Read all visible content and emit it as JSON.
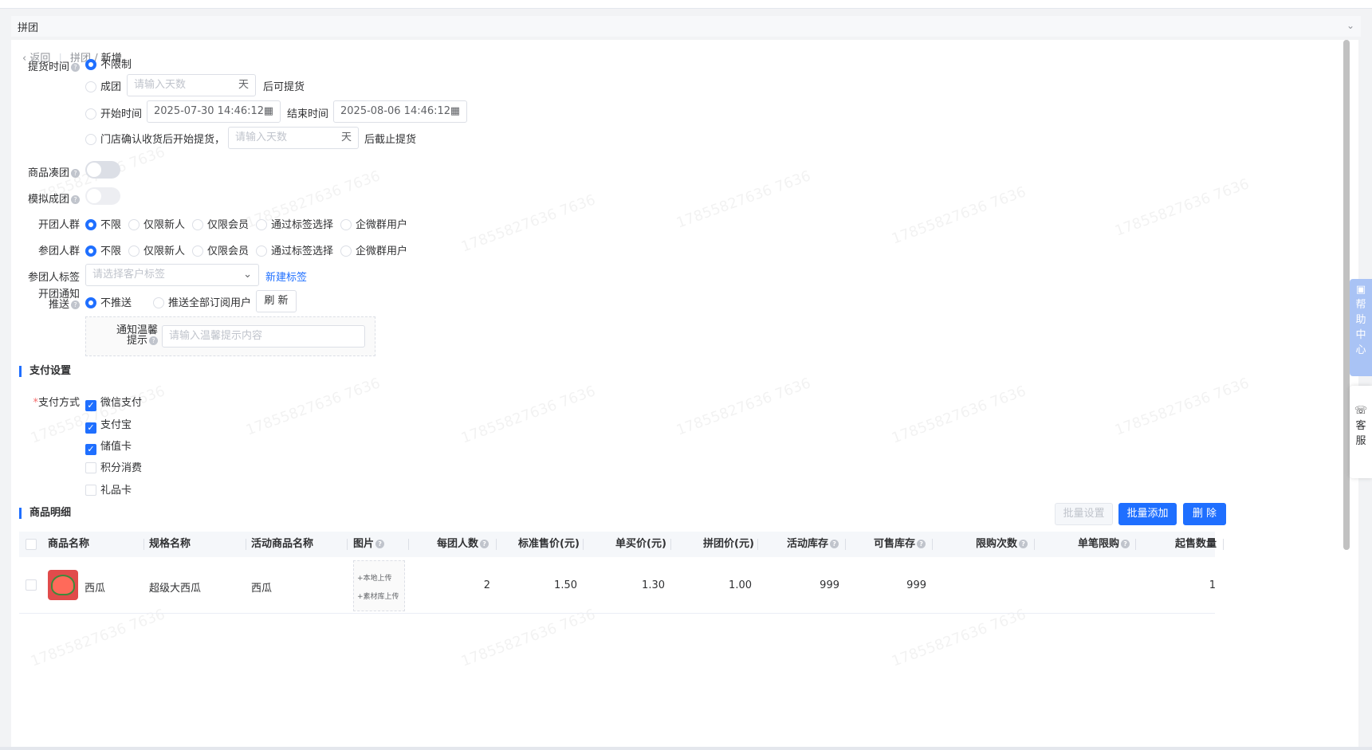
{
  "tab": {
    "label": "拼团"
  },
  "breadcrumb": {
    "back": "返回",
    "parent": "拼团",
    "current": "新增"
  },
  "pickup": {
    "label": "提货时间",
    "opt_unlimited": "不限制",
    "opt_group": "成团",
    "days_placeholder": "请输入天数",
    "days_unit": "天",
    "after_pickup": "后可提货",
    "opt_start": "开始时间",
    "start_value": "2025-07-30 14:46:12",
    "end_label": "结束时间",
    "end_value": "2025-08-06 14:46:12",
    "opt_store": "门店确认收货后开始提货，",
    "store_placeholder": "请输入天数",
    "store_unit": "天",
    "after_stop": "后截止提货"
  },
  "gather": {
    "label": "商品凑团"
  },
  "simulate": {
    "label": "模拟成团"
  },
  "opener": {
    "label": "开团人群",
    "options": [
      "不限",
      "仅限新人",
      "仅限会员",
      "通过标签选择",
      "企微群用户"
    ],
    "selected": 0
  },
  "joiner": {
    "label": "参团人群",
    "options": [
      "不限",
      "仅限新人",
      "仅限会员",
      "通过标签选择",
      "企微群用户"
    ],
    "selected": 0
  },
  "tags": {
    "label": "参团人标签",
    "placeholder": "请选择客户标签",
    "new_link": "新建标签"
  },
  "notify": {
    "label_line1": "开团通知",
    "label_line2": "推送",
    "opt_none": "不推送",
    "opt_all": "推送全部订阅用户",
    "refresh": "刷 新",
    "tip_label_line1": "通知温馨",
    "tip_label_line2": "提示",
    "tip_placeholder": "请输入温馨提示内容"
  },
  "payment": {
    "section": "支付设置",
    "label": "支付方式",
    "required": "*",
    "methods": [
      {
        "name": "微信支付",
        "checked": true
      },
      {
        "name": "支付宝",
        "checked": true
      },
      {
        "name": "储值卡",
        "checked": true
      },
      {
        "name": "积分消费",
        "checked": false
      },
      {
        "name": "礼品卡",
        "checked": false
      }
    ]
  },
  "goods": {
    "section": "商品明细",
    "batch_set": "批量设置",
    "batch_add": "批量添加",
    "delete": "删 除",
    "columns": [
      "商品名称",
      "规格名称",
      "活动商品名称",
      "图片",
      "每团人数",
      "标准售价(元)",
      "单买价(元)",
      "拼团价(元)",
      "活动库存",
      "可售库存",
      "限购次数",
      "单笔限购",
      "起售数量"
    ],
    "rows": [
      {
        "name": "西瓜",
        "spec": "超级大西瓜",
        "activity_name": "西瓜",
        "upload_local": "+本地上传",
        "upload_lib": "+素材库上传",
        "per_group": "2",
        "std_price": "1.50",
        "single_price": "1.30",
        "group_price": "1.00",
        "activity_stock": "999",
        "sale_stock": "999",
        "limit_times": "",
        "limit_per_order": "",
        "min_qty": "1"
      }
    ]
  },
  "sidebar": {
    "help": [
      "帮",
      "助",
      "中",
      "心"
    ],
    "service": [
      "客",
      "服"
    ]
  },
  "watermark": "17855827636 7636",
  "colors": {
    "primary": "#1f6fff",
    "border": "#dcdfe6",
    "page_bg": "#f2f3f5"
  }
}
